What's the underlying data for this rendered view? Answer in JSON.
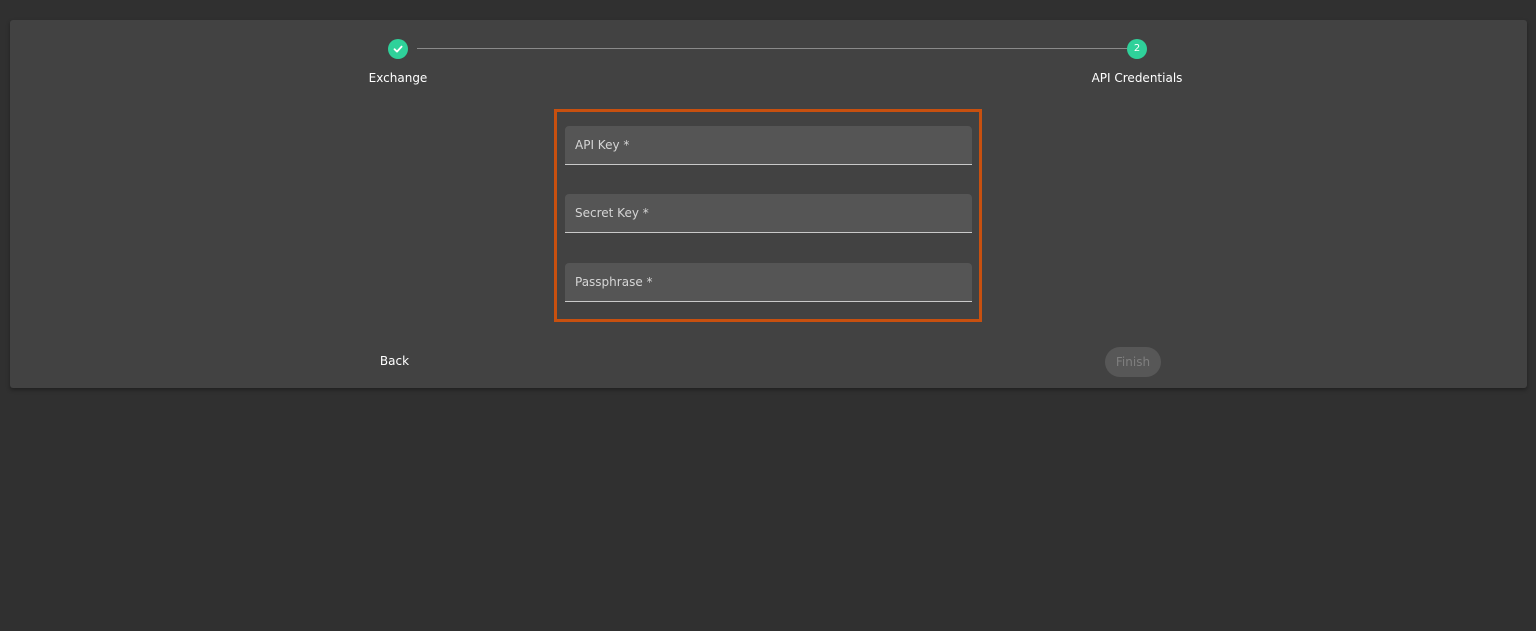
{
  "stepper": {
    "steps": [
      {
        "label": "Exchange",
        "state": "completed",
        "icon": "check-icon"
      },
      {
        "label": "API Credentials",
        "state": "active",
        "number": "2"
      }
    ],
    "accent_color": "#2fd19a"
  },
  "form": {
    "highlight_color": "#c8500f",
    "fields": [
      {
        "label": "API Key *",
        "value": ""
      },
      {
        "label": "Secret Key *",
        "value": ""
      },
      {
        "label": "Passphrase *",
        "value": ""
      }
    ]
  },
  "actions": {
    "back_label": "Back",
    "finish_label": "Finish"
  }
}
